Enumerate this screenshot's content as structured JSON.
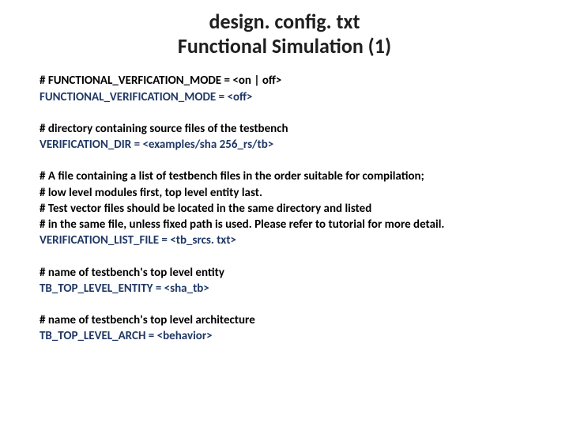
{
  "title": {
    "line1": "design. config. txt",
    "line2": "Functional Simulation (1)"
  },
  "sections": [
    {
      "lines": [
        {
          "cls": "bold",
          "text": "# FUNCTIONAL_VERFICATION_MODE = <on | off>"
        },
        {
          "cls": "navy",
          "text": "FUNCTIONAL_VERIFICATION_MODE = <off>"
        }
      ]
    },
    {
      "lines": [
        {
          "cls": "bold",
          "text": "# directory containing source files of the testbench"
        },
        {
          "cls": "navy",
          "text": "VERIFICATION_DIR = <examples/sha 256_rs/tb>"
        }
      ]
    },
    {
      "lines": [
        {
          "cls": "bold",
          "text": "# A file containing a list of testbench files in the order suitable for compilation;"
        },
        {
          "cls": "bold",
          "text": "# low level modules first, top level entity last."
        },
        {
          "cls": "bold",
          "text": "# Test vector files should be located in the same directory and listed"
        },
        {
          "cls": "bold",
          "text": "# in the same file, unless fixed path is used. Please refer to tutorial for more detail."
        },
        {
          "cls": "navy",
          "text": "VERIFICATION_LIST_FILE = <tb_srcs. txt>"
        }
      ]
    },
    {
      "lines": [
        {
          "cls": "bold",
          "text": "# name of testbench's top level entity"
        },
        {
          "cls": "navy",
          "text": "TB_TOP_LEVEL_ENTITY = <sha_tb>"
        }
      ]
    },
    {
      "lines": [
        {
          "cls": "bold",
          "text": "# name of testbench's top level architecture"
        },
        {
          "cls": "navy",
          "text": "TB_TOP_LEVEL_ARCH = <behavior>"
        }
      ]
    }
  ]
}
